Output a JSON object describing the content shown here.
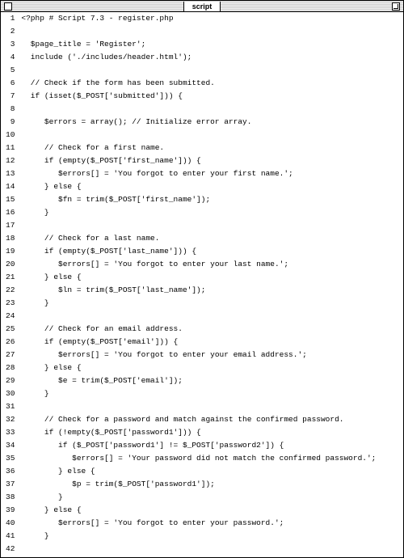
{
  "window": {
    "title": "script"
  },
  "lines": [
    {
      "n": 1,
      "t": "<?php # Script 7.3 - register.php"
    },
    {
      "n": 2,
      "t": ""
    },
    {
      "n": 3,
      "t": "  $page_title = 'Register';"
    },
    {
      "n": 4,
      "t": "  include ('./includes/header.html');"
    },
    {
      "n": 5,
      "t": ""
    },
    {
      "n": 6,
      "t": "  // Check if the form has been submitted."
    },
    {
      "n": 7,
      "t": "  if (isset($_POST['submitted'])) {"
    },
    {
      "n": 8,
      "t": ""
    },
    {
      "n": 9,
      "t": "     $errors = array(); // Initialize error array."
    },
    {
      "n": 10,
      "t": ""
    },
    {
      "n": 11,
      "t": "     // Check for a first name."
    },
    {
      "n": 12,
      "t": "     if (empty($_POST['first_name'])) {"
    },
    {
      "n": 13,
      "t": "        $errors[] = 'You forgot to enter your first name.';"
    },
    {
      "n": 14,
      "t": "     } else {"
    },
    {
      "n": 15,
      "t": "        $fn = trim($_POST['first_name']);"
    },
    {
      "n": 16,
      "t": "     }"
    },
    {
      "n": 17,
      "t": ""
    },
    {
      "n": 18,
      "t": "     // Check for a last name."
    },
    {
      "n": 19,
      "t": "     if (empty($_POST['last_name'])) {"
    },
    {
      "n": 20,
      "t": "        $errors[] = 'You forgot to enter your last name.';"
    },
    {
      "n": 21,
      "t": "     } else {"
    },
    {
      "n": 22,
      "t": "        $ln = trim($_POST['last_name']);"
    },
    {
      "n": 23,
      "t": "     }"
    },
    {
      "n": 24,
      "t": ""
    },
    {
      "n": 25,
      "t": "     // Check for an email address."
    },
    {
      "n": 26,
      "t": "     if (empty($_POST['email'])) {"
    },
    {
      "n": 27,
      "t": "        $errors[] = 'You forgot to enter your email address.';"
    },
    {
      "n": 28,
      "t": "     } else {"
    },
    {
      "n": 29,
      "t": "        $e = trim($_POST['email']);"
    },
    {
      "n": 30,
      "t": "     }"
    },
    {
      "n": 31,
      "t": ""
    },
    {
      "n": 32,
      "t": "     // Check for a password and match against the confirmed password."
    },
    {
      "n": 33,
      "t": "     if (!empty($_POST['password1'])) {"
    },
    {
      "n": 34,
      "t": "        if ($_POST['password1'] != $_POST['password2']) {"
    },
    {
      "n": 35,
      "t": "           $errors[] = 'Your password did not match the confirmed password.';"
    },
    {
      "n": 36,
      "t": "        } else {"
    },
    {
      "n": 37,
      "t": "           $p = trim($_POST['password1']);"
    },
    {
      "n": 38,
      "t": "        }"
    },
    {
      "n": 39,
      "t": "     } else {"
    },
    {
      "n": 40,
      "t": "        $errors[] = 'You forgot to enter your password.';"
    },
    {
      "n": 41,
      "t": "     }"
    },
    {
      "n": 42,
      "t": ""
    }
  ]
}
